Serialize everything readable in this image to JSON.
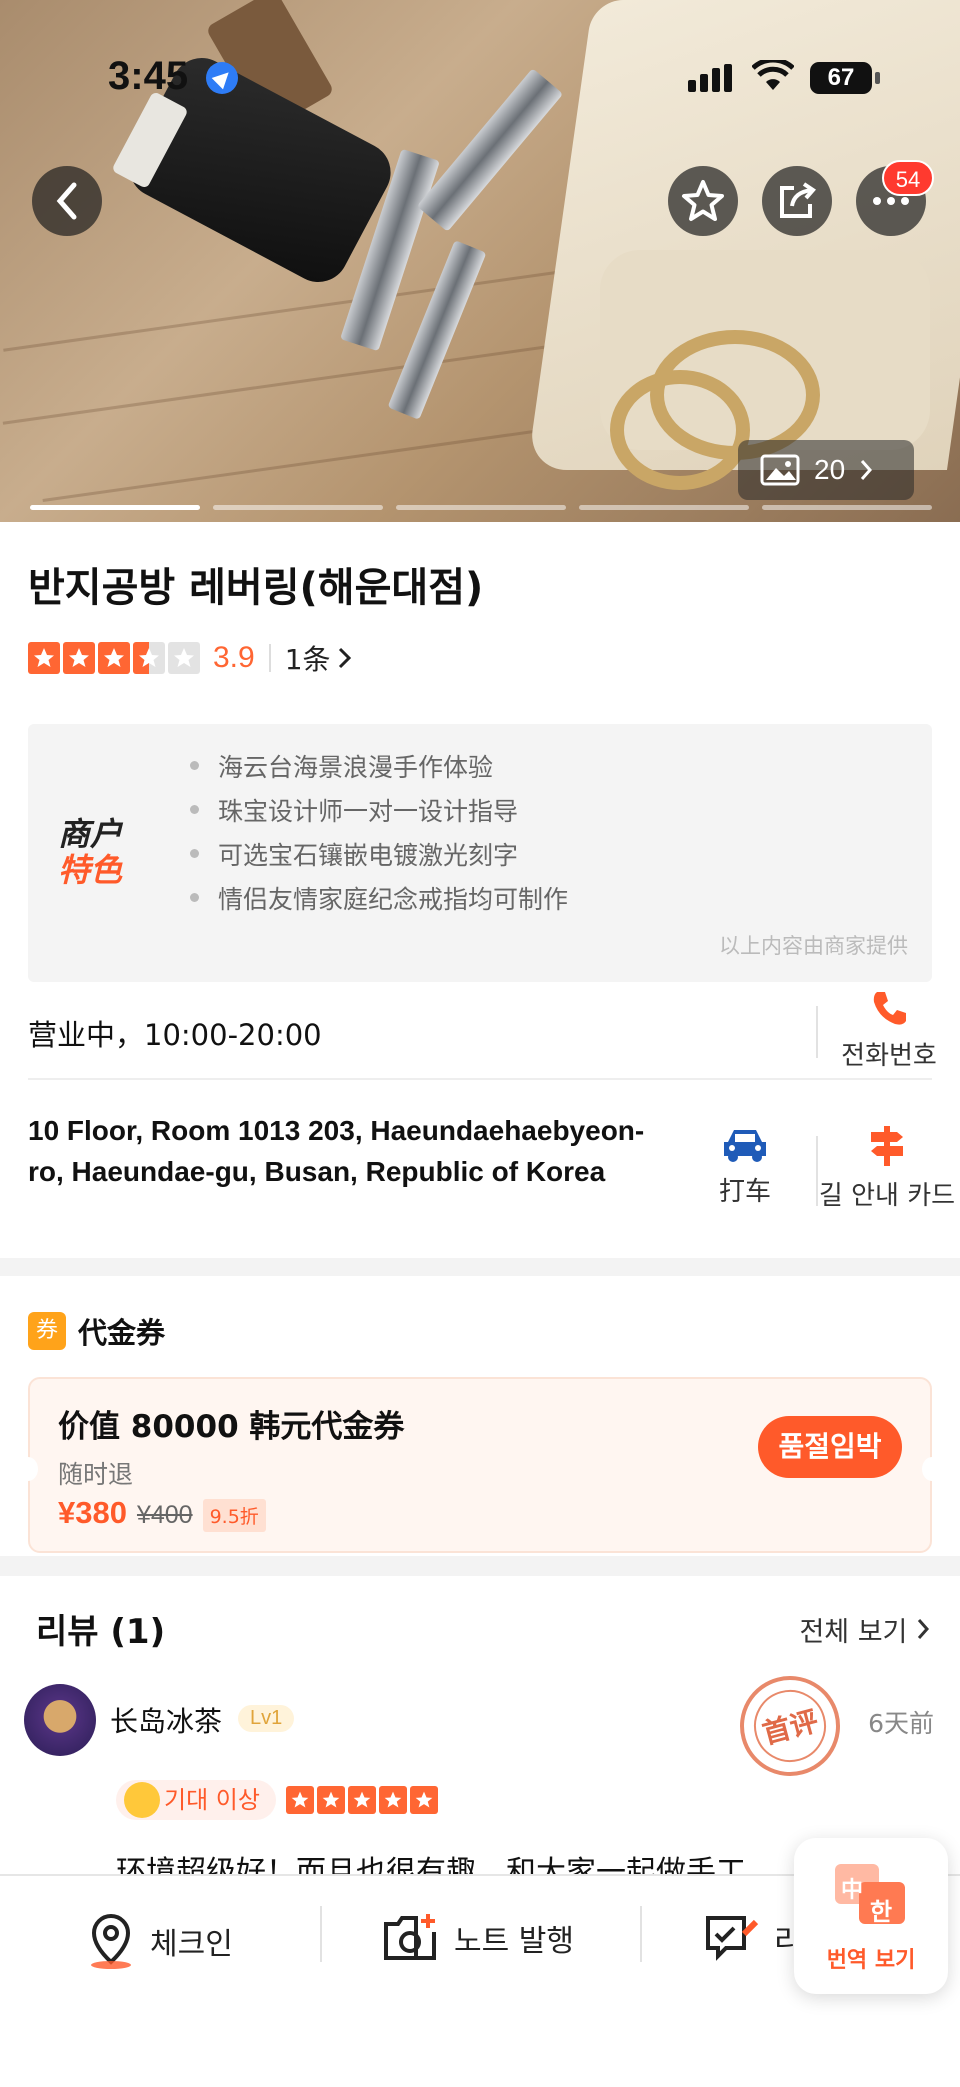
{
  "status_bar": {
    "time": "3:45",
    "battery": "67"
  },
  "hero": {
    "photo_count": "20",
    "badge_count": "54"
  },
  "shop": {
    "name": "반지공방 레버링(해운대점)",
    "rating": "3.9",
    "review_count": "1条"
  },
  "features": {
    "logo_line1": "商户",
    "logo_line2": "特色",
    "items": [
      "海云台海景浪漫手作体验",
      "珠宝设计师一对一设计指导",
      "可选宝石镶嵌电镀激光刻字",
      "情侣友情家庭纪念戒指均可制作"
    ],
    "note": "以上内容由商家提供"
  },
  "info": {
    "hours": "营业中，10:00-20:00",
    "phone_label": "전화번호",
    "address": "10 Floor, Room 1013 203, Haeundaehaebyeon-ro, Haeundae-gu, Busan, Republic of Korea",
    "taxi_label": "打车",
    "direction_label": "길 안내 카드"
  },
  "voucher": {
    "icon_text": "券",
    "section_title": "代金券",
    "title": "价值 80000 韩元代金券",
    "refund": "随时退",
    "price": "¥380",
    "original_price": "¥400",
    "discount": "9.5折",
    "button": "품절임박"
  },
  "reviews": {
    "title": "리뷰 (1)",
    "view_all": "전체 보기",
    "user": "长岛冰茶",
    "level": "Lv1",
    "stamp": "首评",
    "time_ago": "6天前",
    "expect_tag": "기대 이상",
    "text": "环境超级好！而且也很有趣，和大家一起做手工"
  },
  "bottom_bar": {
    "checkin": "체크인",
    "note": "노트 발행",
    "review": "리",
    "translate": "번역 보기",
    "translate_zh": "中",
    "translate_ko": "한"
  },
  "colors": {
    "accent": "#ff5a2a",
    "star": "#ff6633",
    "voucher_icon": "#ffa31a",
    "taxi": "#1f5bb8"
  }
}
